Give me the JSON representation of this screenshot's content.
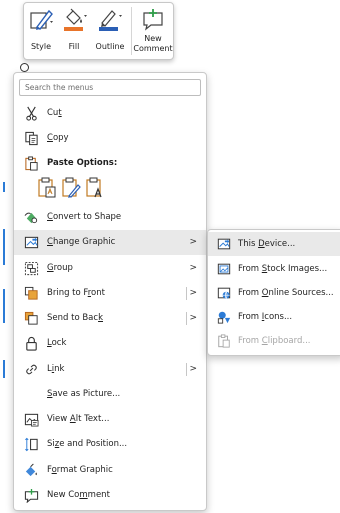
{
  "colors": {
    "accent_blue": "#2b7bd6",
    "fill_orange": "#e8742a",
    "style_blue": "#2b5fb5",
    "new_comment_green": "#2e9d48",
    "lock_dark": "#333333",
    "disabled_text": "#a6a6a6",
    "hover_bg": "#e9e9e9"
  },
  "mini_toolbar": {
    "style": {
      "label": "Style",
      "icon": "shape-style-icon"
    },
    "fill": {
      "label": "Fill",
      "icon": "paint-bucket-icon"
    },
    "outline": {
      "label": "Outline",
      "icon": "pen-outline-icon"
    },
    "new_comment": {
      "label_line1": "New",
      "label_line2": "Comment",
      "icon": "new-comment-icon"
    }
  },
  "menu": {
    "search_placeholder": "Search the menus",
    "items": {
      "cut": {
        "pre": "Cu",
        "key": "t",
        "post": "",
        "icon": "scissors-icon"
      },
      "copy": {
        "pre": "",
        "key": "C",
        "post": "opy",
        "icon": "copy-icon"
      },
      "paste_options": {
        "label": "Paste Options:",
        "icon": "clipboard-icon"
      },
      "convert": {
        "pre": "",
        "key": "C",
        "post": "onvert to Shape",
        "icon": "convert-to-shape-icon"
      },
      "change_graphic": {
        "pre": "",
        "key": "C",
        "post": "hange Graphic",
        "icon": "change-graphic-icon",
        "arrow": ">"
      },
      "group": {
        "pre": "",
        "key": "G",
        "post": "roup",
        "icon": "group-icon",
        "arrow": ">"
      },
      "bring_to_front": {
        "pre": "Bring to F",
        "key": "r",
        "post": "ont",
        "icon": "bring-to-front-icon",
        "arrow": ">"
      },
      "send_to_back": {
        "pre": "Send to Bac",
        "key": "k",
        "post": "",
        "icon": "send-to-back-icon",
        "arrow": ">"
      },
      "lock": {
        "pre": "",
        "key": "L",
        "post": "ock",
        "icon": "lock-icon"
      },
      "link": {
        "pre": "L",
        "key": "i",
        "post": "nk",
        "icon": "link-icon",
        "arrow": ">"
      },
      "save_as_picture": {
        "pre": "",
        "key": "S",
        "post": "ave as Picture...",
        "icon": ""
      },
      "view_alt_text": {
        "pre": "View ",
        "key": "A",
        "post": "lt Text...",
        "icon": "alt-text-icon"
      },
      "size_position": {
        "pre": "Si",
        "key": "z",
        "post": "e and Position...",
        "icon": "size-position-icon"
      },
      "format_graphic": {
        "pre": "F",
        "key": "o",
        "post": "rmat Graphic",
        "icon": "format-graphic-icon"
      },
      "new_comment": {
        "pre": "New Co",
        "key": "m",
        "post": "ment",
        "icon": "new-comment-icon"
      }
    },
    "paste_buttons": [
      {
        "name": "paste-keep-source-icon"
      },
      {
        "name": "paste-picture-icon"
      },
      {
        "name": "paste-text-only-icon"
      }
    ]
  },
  "submenu": {
    "items": {
      "this_device": {
        "pre": "This ",
        "key": "D",
        "post": "evice...",
        "icon": "this-device-icon"
      },
      "stock_images": {
        "pre": "From ",
        "key": "S",
        "post": "tock Images...",
        "icon": "stock-images-icon"
      },
      "online_sources": {
        "pre": "From ",
        "key": "O",
        "post": "nline Sources...",
        "icon": "online-sources-icon"
      },
      "icons": {
        "pre": "From ",
        "key": "I",
        "post": "cons...",
        "icon": "icons-icon"
      },
      "clipboard": {
        "pre": "From ",
        "key": "C",
        "post": "lipboard...",
        "icon": "clipboard-paste-icon",
        "disabled": true
      }
    }
  }
}
